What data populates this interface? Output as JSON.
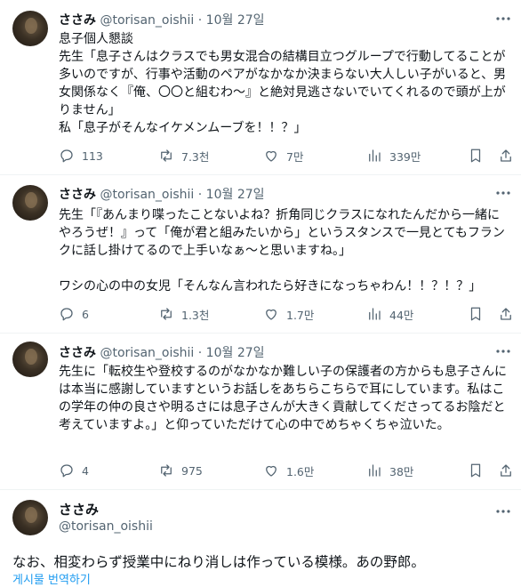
{
  "tweets": [
    {
      "name": "ささみ",
      "handle": "@torisan_oishii",
      "sep": "·",
      "date": "10월 27일",
      "text": "息子個人懇談\n先生「息子さんはクラスでも男女混合の結構目立つグループで行動してることが多いのですが、行事や活動のペアがなかなか決まらない大人しい子がいると、男女関係なく『俺、〇〇と組むわ～』と絶対見逃さないでいてくれるので頭が上がりません」\n私「息子がそんなイケメンムーブを！！？」",
      "replies": "113",
      "reposts": "7.3천",
      "likes": "7만",
      "views": "339만"
    },
    {
      "name": "ささみ",
      "handle": "@torisan_oishii",
      "sep": "·",
      "date": "10월 27일",
      "text": "先生「『あんまり喋ったことないよね？折角同じクラスになれたんだから一緒にやろうぜ！』って「俺が君と組みたいから」というスタンスで一見とてもフランクに話し掛けてるので上手いなぁ～と思いますね。」\n\nワシの心の中の女児「そんなん言われたら好きになっちゃわん！！？！？」",
      "replies": "6",
      "reposts": "1.3천",
      "likes": "1.7만",
      "views": "44만"
    },
    {
      "name": "ささみ",
      "handle": "@torisan_oishii",
      "sep": "·",
      "date": "10월 27일",
      "text": "先生に「転校生や登校するのがなかなか難しい子の保護者の方からも息子さんには本当に感謝していますというお話しをあちらこちらで耳にしています。私はこの学年の仲の良さや明るさには息子さんが大きく貢献してくださってるお陰だと考えていますよ。」と仰っていただけて心の中でめちゃくちゃ泣いた。",
      "replies": "4",
      "reposts": "975",
      "likes": "1.6만",
      "views": "38만"
    }
  ],
  "last": {
    "name": "ささみ",
    "handle": "@torisan_oishii",
    "text": "なお、相変わらず授業中にねり消しは作っている模様。あの野郎。",
    "translate": "게시물 번역하기"
  },
  "icons": [
    "reply-icon",
    "repost-icon",
    "like-icon",
    "views-icon",
    "bookmark-icon",
    "share-icon",
    "more-icon"
  ],
  "colors": {
    "text": "#0f1419",
    "muted": "#536471",
    "link": "#1d9bf0"
  }
}
